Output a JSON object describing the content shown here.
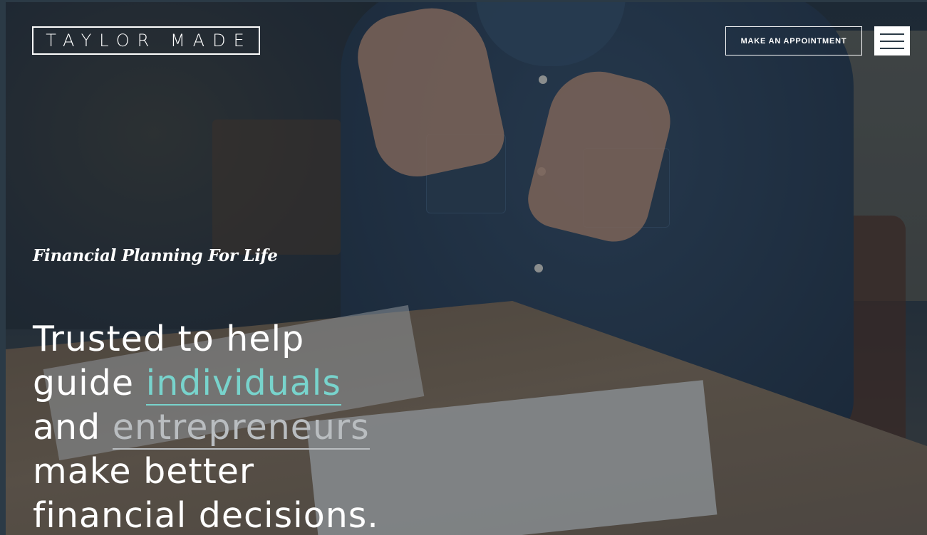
{
  "header": {
    "logo_text": "TAYLOR MADE",
    "appointment_label": "MAKE AN APPOINTMENT",
    "menu_icon": "hamburger-menu-icon"
  },
  "hero": {
    "tagline": "Financial Planning For Life",
    "headline": {
      "line1": "Trusted to help",
      "line2_prefix": "guide ",
      "line2_accent": "individuals",
      "line3_prefix": "and ",
      "line3_muted": "entrepreneurs",
      "line4": "make better",
      "line5": "financial decisions."
    }
  },
  "colors": {
    "accent": "#78d3cc",
    "muted": "#b9bdc0",
    "background": "#2b3a46",
    "text": "#ffffff"
  }
}
